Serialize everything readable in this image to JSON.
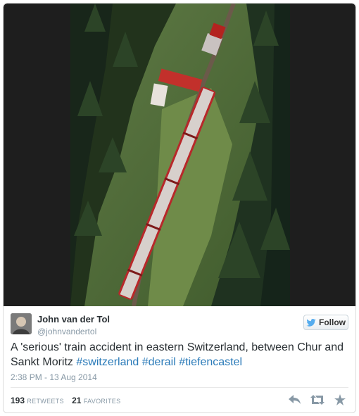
{
  "author": {
    "name": "John van der Tol",
    "handle": "@johnvandertol"
  },
  "follow_button": {
    "label": "Follow",
    "icon": "twitter-bird-icon"
  },
  "tweet": {
    "text_plain": "A 'serious' train accident in eastern Switzerland, between Chur and Sankt Moritz ",
    "hashtags": [
      "#switzerland",
      "#derail",
      "#tiefencastel"
    ],
    "timestamp": "2:38 PM - 13 Aug 2014"
  },
  "stats": {
    "retweets_count": "193",
    "retweets_label": "RETWEETS",
    "favorites_count": "21",
    "favorites_label": "FAVORITES"
  },
  "actions": [
    "reply-icon",
    "retweet-icon",
    "favorite-icon"
  ],
  "colors": {
    "link": "#2b7bb9",
    "bird": "#55acee",
    "muted": "#8899a6"
  }
}
